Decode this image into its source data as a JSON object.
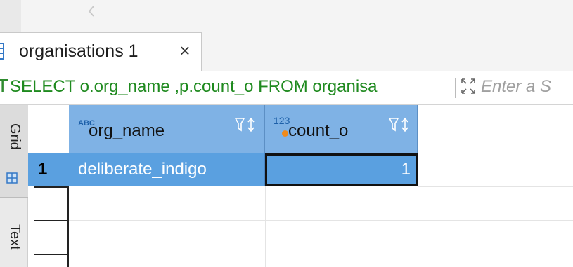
{
  "tab": {
    "label": "organisations 1",
    "close_glyph": "×",
    "icon": "table-icon"
  },
  "query": {
    "type_glyph": "T",
    "text": "SELECT o.org_name ,p.count_o FROM organisa",
    "filter_placeholder": "Enter a S",
    "expand_icon": "expand-icon"
  },
  "side": {
    "grid_label": "Grid",
    "text_label": "Text"
  },
  "grid": {
    "columns": [
      {
        "type_badge": "ABC",
        "name": "org_name"
      },
      {
        "type_badge": "123",
        "name": "count_o"
      }
    ],
    "rows": [
      {
        "num": "1",
        "org_name": "deliberate_indigo",
        "count_o": "1"
      }
    ]
  },
  "colors": {
    "selection": "#5aa0e0",
    "header": "#7fb2e5",
    "query_text": "#1f8a1f",
    "key_dot": "#f08a1a"
  }
}
